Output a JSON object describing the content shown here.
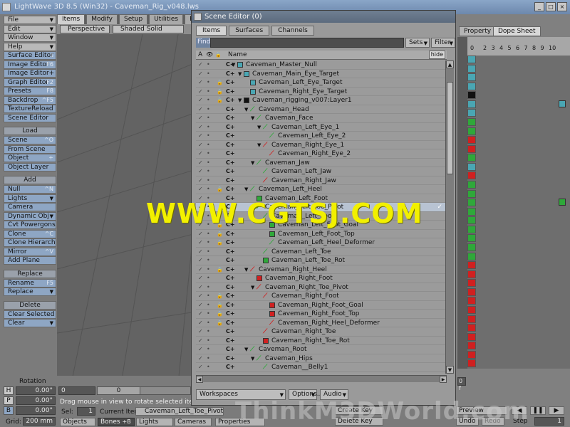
{
  "app": {
    "title": "LightWave 3D 8.5 (Win32) - Caveman_Rig_v048.lws",
    "window_buttons": [
      "_",
      "□",
      "×"
    ]
  },
  "main_tabs": [
    "Items",
    "Modify",
    "Setup",
    "Utilities",
    "Render"
  ],
  "left_menu": [
    {
      "label": "File",
      "drop": true
    },
    {
      "label": "Edit",
      "drop": true
    },
    {
      "label": "Window",
      "drop": true
    },
    {
      "label": "Help",
      "drop": true
    }
  ],
  "left_editors": [
    {
      "label": "Surface Editor",
      "shortcut": "s"
    },
    {
      "label": "Image Editor",
      "shortcut": "F6"
    },
    {
      "label": "Image Editor+",
      "shortcut": ""
    },
    {
      "label": "Graph Editor",
      "shortcut": "F2"
    },
    {
      "label": "Presets",
      "shortcut": "F8"
    },
    {
      "label": "Backdrop",
      "shortcut": "^F5"
    },
    {
      "label": "TextureReload",
      "shortcut": ""
    },
    {
      "label": "Scene Editor",
      "shortcut": ""
    }
  ],
  "load_section": {
    "header": "Load",
    "items": [
      {
        "label": "Scene",
        "shortcut": "^O"
      },
      {
        "label": "From Scene",
        "shortcut": ""
      },
      {
        "label": "Object",
        "shortcut": "+"
      },
      {
        "label": "Object Layer",
        "shortcut": ""
      }
    ]
  },
  "add_section": {
    "header": "Add",
    "items": [
      {
        "label": "Null",
        "shortcut": "^N"
      },
      {
        "label": "Lights",
        "drop": true
      },
      {
        "label": "Camera",
        "shortcut": ""
      },
      {
        "label": "Dynamic Obj",
        "drop": true
      },
      {
        "label": "Cvt Powergons",
        "shortcut": ""
      },
      {
        "label": "Clone",
        "shortcut": "^C"
      },
      {
        "label": "Clone Hierarchy",
        "shortcut": ""
      },
      {
        "label": "Mirror",
        "shortcut": "^V"
      },
      {
        "label": "Add Plane",
        "shortcut": ""
      }
    ]
  },
  "replace_section": {
    "header": "Replace",
    "items": [
      {
        "label": "Rename",
        "shortcut": "F5"
      },
      {
        "label": "Replace",
        "drop": true
      }
    ]
  },
  "delete_section": {
    "header": "Delete",
    "items": [
      {
        "label": "Clear Selected",
        "shortcut": ""
      },
      {
        "label": "Clear",
        "drop": true
      }
    ]
  },
  "viewport": {
    "view_mode": "Perspective",
    "shading_mode": "Shaded Solid"
  },
  "bottom": {
    "rotation_label": "Rotation",
    "h_label": "H",
    "p_label": "P",
    "b_label": "B",
    "h_value": "0.00°",
    "p_value": "0.00°",
    "b_value": "0.00°",
    "grid_label": "Grid:",
    "grid_value": "200 mm",
    "frame_start": "0",
    "frame_slider": "0",
    "status": "Drag mouse in view to rotate selected items.",
    "sel_label": "Sel:",
    "sel_value": "1",
    "current_item_label": "Current Item",
    "current_item": "Caveman_Left_Toe_Pivot",
    "objects": "Objects",
    "bones": "Bones",
    "bones_sc": "+B",
    "lights": "Lights",
    "cameras": "Cameras",
    "properties": "Properties",
    "objects_sc": "+O",
    "lights_sc": "+L",
    "cameras_sc": "+C"
  },
  "scene_editor": {
    "title": "Scene Editor (0)",
    "tabs": [
      "Items",
      "Surfaces",
      "Channels"
    ],
    "find_label": "Find",
    "find_value": "",
    "sets_label": "Sets",
    "filter_label": "Filter",
    "columns": {
      "a": "A",
      "eye": "👁",
      "lock": "🔒",
      "name": "Name"
    },
    "hide_label": "hide",
    "workspaces_label": "Workspaces",
    "options_label": "Options...",
    "audio_label": "Audio"
  },
  "scene_items": [
    {
      "name": "Caveman_Master_Null",
      "indent": 0,
      "type": "null",
      "lock": false,
      "expanded": true
    },
    {
      "name": "Caveman_Main_Eye_Target",
      "indent": 1,
      "type": "null",
      "lock": false,
      "expanded": true
    },
    {
      "name": "Caveman_Left_Eye_Target",
      "indent": 2,
      "type": "null",
      "lock": true
    },
    {
      "name": "Caveman_Right_Eye_Target",
      "indent": 2,
      "type": "null",
      "lock": true
    },
    {
      "name": "Caveman_rigging_v007:Layer1",
      "indent": 1,
      "type": "object",
      "lock": true,
      "expanded": true
    },
    {
      "name": "Caveman_Head",
      "indent": 2,
      "type": "bone-g",
      "lock": false,
      "expanded": true
    },
    {
      "name": "Caveman_Face",
      "indent": 3,
      "type": "bone-g",
      "lock": false,
      "expanded": true
    },
    {
      "name": "Caveman_Left_Eye_1",
      "indent": 4,
      "type": "bone-g",
      "lock": false,
      "expanded": true
    },
    {
      "name": "Caveman_Left_Eye_2",
      "indent": 5,
      "type": "bone-g",
      "lock": false
    },
    {
      "name": "Caveman_Right_Eye_1",
      "indent": 4,
      "type": "bone-r",
      "lock": false,
      "expanded": true
    },
    {
      "name": "Caveman_Right_Eye_2",
      "indent": 5,
      "type": "bone-r",
      "lock": false
    },
    {
      "name": "Caveman_Jaw",
      "indent": 3,
      "type": "bone-g",
      "lock": false,
      "expanded": true
    },
    {
      "name": "Caveman_Left_Jaw",
      "indent": 4,
      "type": "bone-g",
      "lock": false
    },
    {
      "name": "Caveman_Right_Jaw",
      "indent": 4,
      "type": "bone-r",
      "lock": false
    },
    {
      "name": "Caveman_Left_Heel",
      "indent": 2,
      "type": "bone-g",
      "lock": true,
      "expanded": true
    },
    {
      "name": "Caveman_Left_Foot",
      "indent": 3,
      "type": "null-g",
      "lock": false
    },
    {
      "name": "Caveman_Left_Toe_Pivot",
      "indent": 3,
      "type": "bone-g",
      "lock": false,
      "selected": true,
      "check": "✓"
    },
    {
      "name": "Caveman_Left_Foot",
      "indent": 4,
      "type": "bone-g",
      "lock": false
    },
    {
      "name": "Caveman_Left_Foot_Goal",
      "indent": 5,
      "type": "null-g",
      "lock": true
    },
    {
      "name": "Caveman_Left_Foot_Top",
      "indent": 5,
      "type": "null-g",
      "lock": true
    },
    {
      "name": "Caveman_Left_Heel_Deformer",
      "indent": 5,
      "type": "bone-g",
      "lock": true
    },
    {
      "name": "Caveman_Left_Toe",
      "indent": 4,
      "type": "bone-g",
      "lock": false
    },
    {
      "name": "Caveman_Left_Toe_Rot",
      "indent": 4,
      "type": "null-g",
      "lock": false
    },
    {
      "name": "Caveman_Right_Heel",
      "indent": 2,
      "type": "bone-r",
      "lock": true,
      "expanded": true
    },
    {
      "name": "Caveman_Right_Foot",
      "indent": 3,
      "type": "null-r",
      "lock": false
    },
    {
      "name": "Caveman_Right_Toe_Pivot",
      "indent": 3,
      "type": "bone-r",
      "lock": false,
      "expanded": true
    },
    {
      "name": "Caveman_Right_Foot",
      "indent": 4,
      "type": "bone-r",
      "lock": true
    },
    {
      "name": "Caveman_Right_Foot_Goal",
      "indent": 5,
      "type": "null-r",
      "lock": true
    },
    {
      "name": "Caveman_Right_Foot_Top",
      "indent": 5,
      "type": "null-r",
      "lock": true
    },
    {
      "name": "Caveman_Right_Heel_Deformer",
      "indent": 5,
      "type": "bone-r",
      "lock": true
    },
    {
      "name": "Caveman_Right_Toe",
      "indent": 4,
      "type": "bone-r",
      "lock": false
    },
    {
      "name": "Caveman_Right_Toe_Rot",
      "indent": 4,
      "type": "null-r",
      "lock": false
    },
    {
      "name": "Caveman_Root",
      "indent": 2,
      "type": "bone-g",
      "lock": false,
      "expanded": true
    },
    {
      "name": "Caveman_Hips",
      "indent": 3,
      "type": "bone-g",
      "lock": false,
      "expanded": true
    },
    {
      "name": "Caveman__Belly1",
      "indent": 4,
      "type": "bone-g",
      "lock": false
    }
  ],
  "right_panel": {
    "tabs": [
      "Property",
      "Dope Sheet"
    ],
    "ruler_ticks": [
      "0",
      "2",
      "3",
      "4",
      "5",
      "6",
      "7",
      "8",
      "9",
      "10"
    ],
    "frame_field": "0 f",
    "preview_label": "Preview",
    "undo_label": "Undo",
    "redo_label": "Redo",
    "step_label": "Step",
    "step_value": "1",
    "create_key": "Create Key",
    "delete_key": "Delete Key",
    "dope_colors": [
      "#4aa6b3",
      "#4aa6b3",
      "#4aa6b3",
      "#4aa6b3",
      "#111111",
      "#4aa6b3",
      "#4aa6b3",
      "#2fa83a",
      "#2fa83a",
      "#d02020",
      "#d02020",
      "#2fa83a",
      "#4aa6b3",
      "#d02020",
      "#2fa83a",
      "#2fa83a",
      "#2fa83a",
      "#2fa83a",
      "#2fa83a",
      "#2fa83a",
      "#2fa83a",
      "#2fa83a",
      "#2fa83a",
      "#d02020",
      "#d02020",
      "#d02020",
      "#d02020",
      "#d02020",
      "#d02020",
      "#d02020",
      "#d02020",
      "#d02020",
      "#d02020",
      "#d02020",
      "#d02020"
    ]
  },
  "watermark": {
    "text": "WWW.CGTSJ.COM",
    "text2": "ThinkM3DWorld.com"
  },
  "colors": {
    "accent_blue": "#8ea6c4",
    "green_bone": "#2fa83a",
    "red_bone": "#d02020",
    "null_cyan": "#4aa6b3"
  }
}
